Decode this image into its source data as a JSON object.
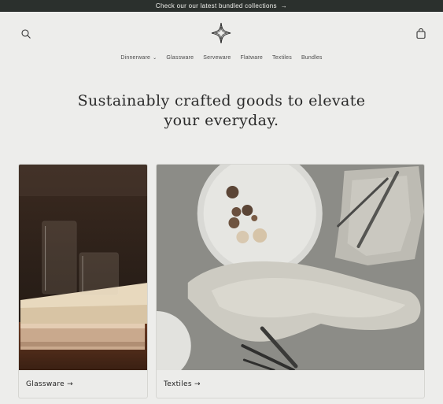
{
  "announcement": {
    "text": "Check our our latest bundled collections",
    "arrow": "→"
  },
  "header": {
    "search_icon": "search-icon",
    "logo_icon": "four-point-star-logo",
    "cart_icon": "shopping-bag-icon"
  },
  "nav": {
    "items": [
      {
        "label": "Dinnerware",
        "dropdown": true
      },
      {
        "label": "Glassware"
      },
      {
        "label": "Serveware"
      },
      {
        "label": "Flatware"
      },
      {
        "label": "Textiles"
      },
      {
        "label": "Bundles"
      }
    ],
    "chevron": "⌄"
  },
  "hero": {
    "line1": "Sustainably crafted goods to elevate",
    "line2": "your everyday."
  },
  "collections": [
    {
      "label": "Glassware →"
    },
    {
      "label": "Textiles →"
    }
  ],
  "colors": {
    "announcement_bg": "#2b302d",
    "page_bg": "#ededeb",
    "text": "#2b2b2b"
  }
}
